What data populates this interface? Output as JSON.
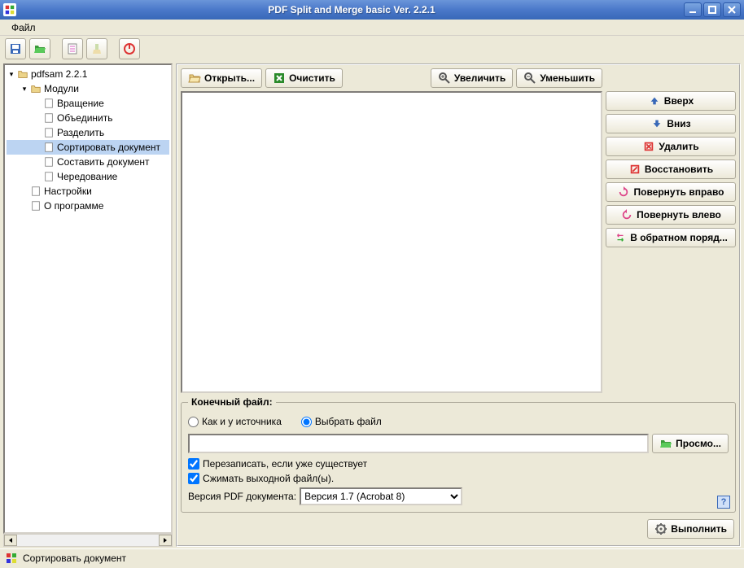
{
  "window": {
    "title": "PDF Split and Merge basic Ver. 2.2.1"
  },
  "menu": {
    "file": "Файл"
  },
  "tree": {
    "root": "pdfsam 2.2.1",
    "modules_label": "Модули",
    "modules": [
      "Вращение",
      "Объединить",
      "Разделить",
      "Сортировать документ",
      "Составить документ",
      "Чередование"
    ],
    "selected_index": 3,
    "settings": "Настройки",
    "about": "О программе"
  },
  "buttons": {
    "open": "Открыть...",
    "clear": "Очистить",
    "zoom_in": "Увеличить",
    "zoom_out": "Уменьшить",
    "up": "Вверх",
    "down": "Вниз",
    "delete": "Удалить",
    "restore": "Восстановить",
    "rotate_right": "Повернуть вправо",
    "rotate_left": "Повернуть влево",
    "reverse": "В обратном поряд...",
    "browse": "Просмо...",
    "run": "Выполнить"
  },
  "output": {
    "legend": "Конечный файл:",
    "radio_same": "Как и у источника",
    "radio_choose": "Выбрать файл",
    "radio_selected": "choose",
    "path_value": "",
    "overwrite": "Перезаписать, если уже существует",
    "overwrite_checked": true,
    "compress": "Сжимать выходной файл(ы).",
    "compress_checked": true,
    "version_label": "Версия PDF документа:",
    "version_value": "Версия 1.7 (Acrobat 8)"
  },
  "status": {
    "text": "Сортировать документ"
  },
  "icons": {
    "folder_open": "folder-open",
    "broom": "broom",
    "zoom_in": "zoom-in",
    "zoom_out": "zoom-out"
  }
}
